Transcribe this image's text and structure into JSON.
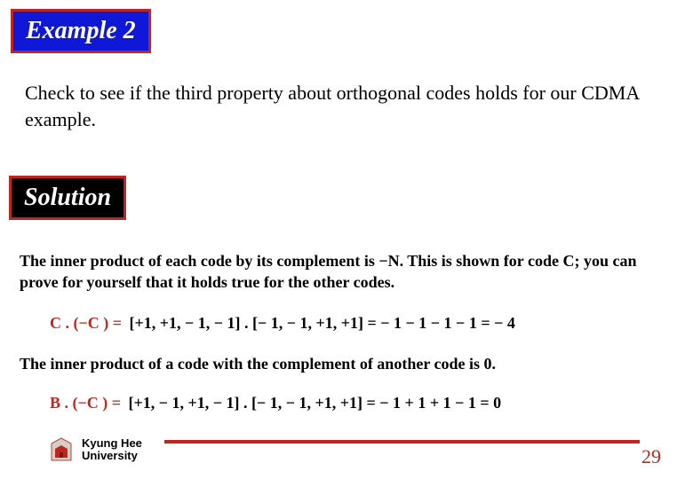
{
  "header": {
    "title": "Example 2"
  },
  "question": "Check to see if the third property about orthogonal codes holds for our CDMA example.",
  "solution_header": "Solution",
  "intro1": "The inner product of each code by its complement is −N. This is shown for code C; you can prove for yourself that it holds true for the other codes.",
  "eq1": {
    "lhs": "C . (−C ) =",
    "rhs": "[+1,  +1, − 1, − 1] . [− 1, − 1, +1, +1] = − 1 − 1 − 1 − 1 = − 4"
  },
  "intro2": "The inner product of a code with the complement of another code is 0.",
  "eq2": {
    "lhs": "B . (−C ) =",
    "rhs": "[+1,  − 1, +1, − 1] . [− 1, − 1, +1, +1] =  − 1 + 1 + 1 − 1 = 0"
  },
  "footer": {
    "university_line1": "Kyung Hee",
    "university_line2": "University",
    "page_number": "29"
  }
}
